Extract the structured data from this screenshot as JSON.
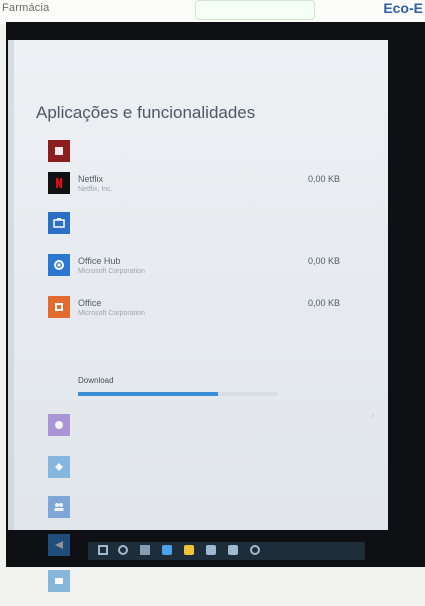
{
  "overlay": {
    "left_text": "Farmácia",
    "brand_text": "Eco-E"
  },
  "header": {
    "title": "Aplicações e funcionalidades"
  },
  "apps": [
    {
      "name": "Netflix",
      "publisher": "Netflix, Inc.",
      "size": "0,00 KB",
      "icon": "netflix-icon",
      "color": "#111111"
    },
    {
      "name": "Office Hub",
      "publisher": "Microsoft Corporation",
      "size": "0,00 KB",
      "icon": "store-icon",
      "color": "#2b77d1"
    },
    {
      "name": "Office",
      "publisher": "Microsoft Corporation",
      "size": "0,00 KB",
      "icon": "office-icon",
      "color": "#e46b2e"
    }
  ],
  "office_progress": {
    "status": "Download",
    "progress": 0.7,
    "accent": "#3c8ed6"
  },
  "colors": {
    "brand_blue": "#2f5fa6",
    "screen_bg": "#e9edf1"
  }
}
